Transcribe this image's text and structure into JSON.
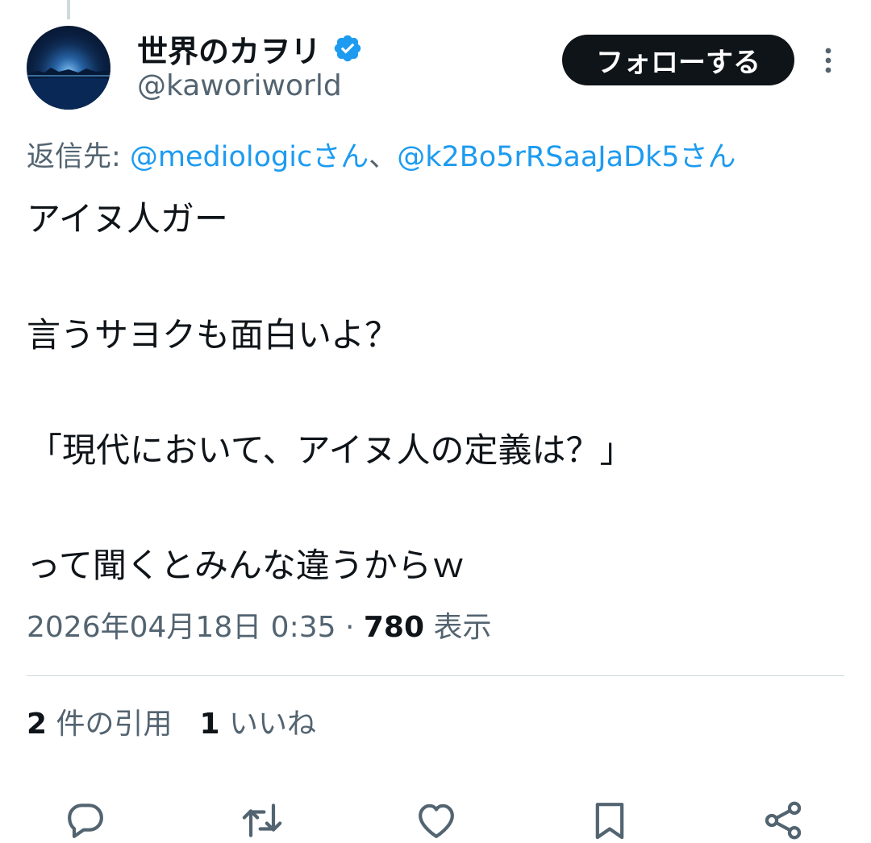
{
  "author": {
    "display_name": "世界のカヲリ",
    "handle": "@kaworiworld"
  },
  "follow_label": "フォローする",
  "reply_to": {
    "prefix": "返信先: ",
    "mention1": "@mediologicさん",
    "separator": "、",
    "mention2": "@k2Bo5rRSaaJaDk5さん"
  },
  "tweet_lines": [
    "アイヌ人ガー",
    "言うサヨクも面白いよ？",
    "「現代において、アイヌ人の定義は？」",
    "って聞くとみんな違うからｗ"
  ],
  "meta": {
    "timestamp": "2026年04月18日 0:35",
    "dot": " · ",
    "views_count": "780",
    "views_label": " 表示"
  },
  "stats": {
    "quotes_count": "2",
    "quotes_label": " 件の引用",
    "likes_count": "1",
    "likes_label": " いいね"
  },
  "icons": {
    "verified": "verified-badge-icon",
    "more": "more-vertical-icon",
    "actions": [
      "reply-icon",
      "retweet-icon",
      "like-icon",
      "bookmark-icon",
      "share-icon"
    ]
  },
  "colors": {
    "accent": "#1d9bf0",
    "text": "#0f1419",
    "secondary": "#536471",
    "follow_bg": "#0f1419",
    "divider": "#cfd9de"
  }
}
